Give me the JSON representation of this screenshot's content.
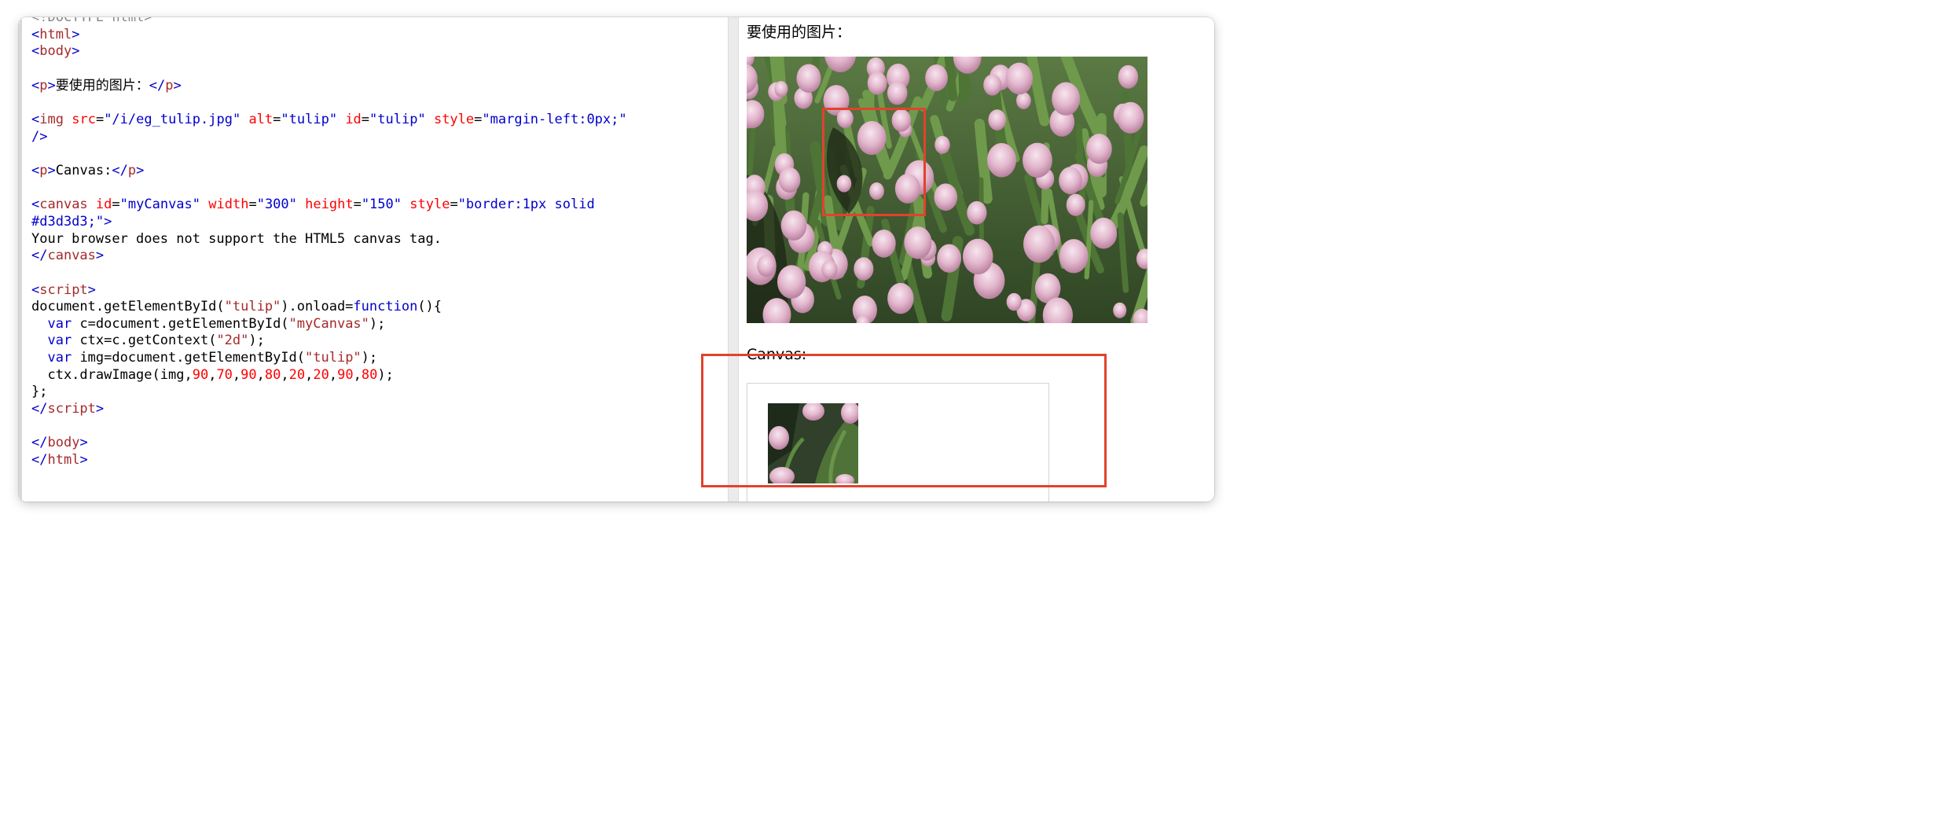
{
  "code_editor": {
    "lines": [
      [
        {
          "t": "<!DOCTYPE html>",
          "c": "cn"
        }
      ],
      [
        {
          "t": "<",
          "c": "tg"
        },
        {
          "t": "html",
          "c": "tn"
        },
        {
          "t": ">",
          "c": "tg"
        }
      ],
      [
        {
          "t": "<",
          "c": "tg"
        },
        {
          "t": "body",
          "c": "tn"
        },
        {
          "t": ">",
          "c": "tg"
        }
      ],
      [],
      [
        {
          "t": "<",
          "c": "tg"
        },
        {
          "t": "p",
          "c": "tn"
        },
        {
          "t": ">",
          "c": "tg"
        },
        {
          "t": "要使用的图片：",
          "c": "pl"
        },
        {
          "t": "</",
          "c": "tg"
        },
        {
          "t": "p",
          "c": "tn"
        },
        {
          "t": ">",
          "c": "tg"
        }
      ],
      [],
      [
        {
          "t": "<",
          "c": "tg"
        },
        {
          "t": "img",
          "c": "tn"
        },
        {
          "t": " ",
          "c": "pl"
        },
        {
          "t": "src",
          "c": "at"
        },
        {
          "t": "=",
          "c": "pl"
        },
        {
          "t": "\"/i/eg_tulip.jpg\"",
          "c": "av"
        },
        {
          "t": " ",
          "c": "pl"
        },
        {
          "t": "alt",
          "c": "at"
        },
        {
          "t": "=",
          "c": "pl"
        },
        {
          "t": "\"tulip\"",
          "c": "av"
        },
        {
          "t": " ",
          "c": "pl"
        },
        {
          "t": "id",
          "c": "at"
        },
        {
          "t": "=",
          "c": "pl"
        },
        {
          "t": "\"tulip\"",
          "c": "av"
        },
        {
          "t": " ",
          "c": "pl"
        },
        {
          "t": "style",
          "c": "at"
        },
        {
          "t": "=",
          "c": "pl"
        },
        {
          "t": "\"margin-left:0px;\"",
          "c": "av"
        }
      ],
      [
        {
          "t": "/>",
          "c": "tg"
        }
      ],
      [],
      [
        {
          "t": "<",
          "c": "tg"
        },
        {
          "t": "p",
          "c": "tn"
        },
        {
          "t": ">",
          "c": "tg"
        },
        {
          "t": "Canvas:",
          "c": "pl"
        },
        {
          "t": "</",
          "c": "tg"
        },
        {
          "t": "p",
          "c": "tn"
        },
        {
          "t": ">",
          "c": "tg"
        }
      ],
      [],
      [
        {
          "t": "<",
          "c": "tg"
        },
        {
          "t": "canvas",
          "c": "tn"
        },
        {
          "t": " ",
          "c": "pl"
        },
        {
          "t": "id",
          "c": "at"
        },
        {
          "t": "=",
          "c": "pl"
        },
        {
          "t": "\"myCanvas\"",
          "c": "av"
        },
        {
          "t": " ",
          "c": "pl"
        },
        {
          "t": "width",
          "c": "at"
        },
        {
          "t": "=",
          "c": "pl"
        },
        {
          "t": "\"300\"",
          "c": "av"
        },
        {
          "t": " ",
          "c": "pl"
        },
        {
          "t": "height",
          "c": "at"
        },
        {
          "t": "=",
          "c": "pl"
        },
        {
          "t": "\"150\"",
          "c": "av"
        },
        {
          "t": " ",
          "c": "pl"
        },
        {
          "t": "style",
          "c": "at"
        },
        {
          "t": "=",
          "c": "pl"
        },
        {
          "t": "\"border:1px solid",
          "c": "av"
        }
      ],
      [
        {
          "t": "#d3d3d3;\"",
          "c": "av"
        },
        {
          "t": ">",
          "c": "tg"
        }
      ],
      [
        {
          "t": "Your browser does not support the HTML5 canvas tag.",
          "c": "pl"
        }
      ],
      [
        {
          "t": "</",
          "c": "tg"
        },
        {
          "t": "canvas",
          "c": "tn"
        },
        {
          "t": ">",
          "c": "tg"
        }
      ],
      [],
      [
        {
          "t": "<",
          "c": "tg"
        },
        {
          "t": "script",
          "c": "tn"
        },
        {
          "t": ">",
          "c": "tg"
        }
      ],
      [
        {
          "t": "document.getElementById(",
          "c": "pl"
        },
        {
          "t": "\"tulip\"",
          "c": "st"
        },
        {
          "t": ").onload=",
          "c": "pl"
        },
        {
          "t": "function",
          "c": "kw"
        },
        {
          "t": "(){",
          "c": "pl"
        }
      ],
      [
        {
          "t": "  ",
          "c": "pl"
        },
        {
          "t": "var",
          "c": "kw"
        },
        {
          "t": " c=document.getElementById(",
          "c": "pl"
        },
        {
          "t": "\"myCanvas\"",
          "c": "st"
        },
        {
          "t": ");",
          "c": "pl"
        }
      ],
      [
        {
          "t": "  ",
          "c": "pl"
        },
        {
          "t": "var",
          "c": "kw"
        },
        {
          "t": " ctx=c.getContext(",
          "c": "pl"
        },
        {
          "t": "\"2d\"",
          "c": "st"
        },
        {
          "t": ");",
          "c": "pl"
        }
      ],
      [
        {
          "t": "  ",
          "c": "pl"
        },
        {
          "t": "var",
          "c": "kw"
        },
        {
          "t": " img=document.getElementById(",
          "c": "pl"
        },
        {
          "t": "\"tulip\"",
          "c": "st"
        },
        {
          "t": ");",
          "c": "pl"
        }
      ],
      [
        {
          "t": "  ctx.drawImage(img,",
          "c": "pl"
        },
        {
          "t": "90",
          "c": "nm"
        },
        {
          "t": ",",
          "c": "pl"
        },
        {
          "t": "70",
          "c": "nm"
        },
        {
          "t": ",",
          "c": "pl"
        },
        {
          "t": "90",
          "c": "nm"
        },
        {
          "t": ",",
          "c": "pl"
        },
        {
          "t": "80",
          "c": "nm"
        },
        {
          "t": ",",
          "c": "pl"
        },
        {
          "t": "20",
          "c": "nm"
        },
        {
          "t": ",",
          "c": "pl"
        },
        {
          "t": "20",
          "c": "nm"
        },
        {
          "t": ",",
          "c": "pl"
        },
        {
          "t": "90",
          "c": "nm"
        },
        {
          "t": ",",
          "c": "pl"
        },
        {
          "t": "80",
          "c": "nm"
        },
        {
          "t": ");",
          "c": "pl"
        }
      ],
      [
        {
          "t": "};",
          "c": "pl"
        }
      ],
      [
        {
          "t": "</",
          "c": "tg"
        },
        {
          "t": "script",
          "c": "tn"
        },
        {
          "t": ">",
          "c": "tg"
        }
      ],
      [],
      [
        {
          "t": "</",
          "c": "tg"
        },
        {
          "t": "body",
          "c": "tn"
        },
        {
          "t": ">",
          "c": "tg"
        }
      ],
      [
        {
          "t": "</",
          "c": "tg"
        },
        {
          "t": "html",
          "c": "tn"
        },
        {
          "t": ">",
          "c": "tg"
        }
      ]
    ]
  },
  "result": {
    "image_heading": "要使用的图片：",
    "canvas_heading": "Canvas:"
  },
  "colors": {
    "annotation_red": "#e0432c",
    "syntax_tag_bracket": "#0000cd",
    "syntax_tag_name": "#a52a2a",
    "syntax_attribute": "#ff0000",
    "syntax_value": "#0000cd",
    "syntax_number": "#ff0000",
    "canvas_border": "#d3d3d3"
  }
}
